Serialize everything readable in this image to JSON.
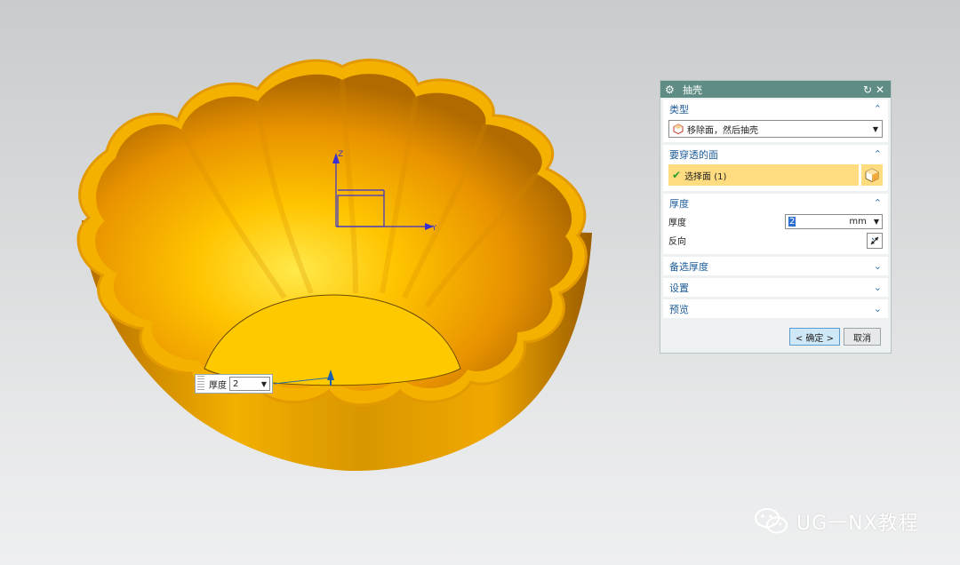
{
  "dialog": {
    "title": "抽壳",
    "type_section": {
      "header": "类型",
      "selected": "移除面，然后抽壳"
    },
    "face_section": {
      "header": "要穿透的面",
      "select_label": "选择面 (1)"
    },
    "thickness_section": {
      "header": "厚度",
      "thickness_label": "厚度",
      "thickness_value": "2",
      "unit": "mm",
      "reverse_label": "反向"
    },
    "alt_thickness_header": "备选厚度",
    "settings_header": "设置",
    "preview_header": "预览",
    "ok_label": "< 确定 >",
    "cancel_label": "取消"
  },
  "viewport": {
    "float_label": "厚度",
    "float_value": "2",
    "axis_z": "Z",
    "axis_y": "Y"
  },
  "watermark": "UG一NX教程",
  "colors": {
    "titlebar": "#5f8c84",
    "highlight": "#ffdc7f",
    "accent": "#1e5c99",
    "part": "#f0a500"
  }
}
